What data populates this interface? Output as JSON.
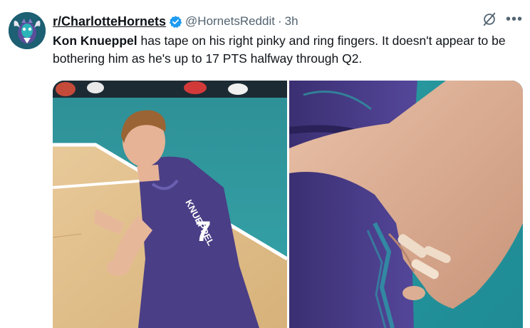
{
  "author": {
    "display_name": "r/CharlotteHornets",
    "handle": "@HornetsReddit",
    "separator": "·",
    "time": "3h",
    "avatar_icon": "hornets-logo-icon",
    "verified_icon": "verified-badge-icon"
  },
  "tweet": {
    "text_bold": "Kon Knueppel",
    "text_rest": " has tape on his right pinky and ring fingers. It doesn't appear to be bothering him as he's up to 17 PTS halfway through Q2."
  },
  "top_actions": {
    "grok_icon": "grok-icon",
    "more_label": "•••"
  },
  "media": {
    "left_photo": "player-jersey-photo",
    "right_photo": "taped-fingers-closeup-photo",
    "jersey_name": "KNUEPPEL",
    "jersey_number": "7"
  },
  "colors": {
    "court_teal": "#2a9a9f",
    "jersey_purple": "#4a3e86",
    "verified_blue": "#1d9bf0",
    "secondary_text": "#536471"
  }
}
